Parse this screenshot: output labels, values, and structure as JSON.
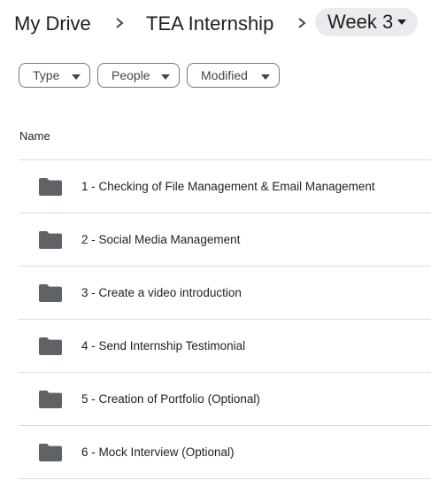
{
  "breadcrumb": {
    "items": [
      {
        "label": "My Drive"
      },
      {
        "label": "TEA Internship"
      }
    ],
    "current": {
      "label": "Week 3"
    }
  },
  "filters": {
    "type": "Type",
    "people": "People",
    "modified": "Modified"
  },
  "list": {
    "column_name": "Name",
    "files": [
      {
        "name": "1 - Checking of File Management & Email Management",
        "icon": "folder-icon"
      },
      {
        "name": "2 - Social Media Management",
        "icon": "folder-icon"
      },
      {
        "name": "3 - Create a video introduction",
        "icon": "folder-icon"
      },
      {
        "name": "4 - Send Internship Testimonial",
        "icon": "folder-icon"
      },
      {
        "name": "5 - Creation of Portfolio (Optional)",
        "icon": "folder-icon"
      },
      {
        "name": "6 - Mock Interview (Optional)",
        "icon": "folder-icon"
      }
    ]
  },
  "colors": {
    "text": "#1f1f1f",
    "folder": "#5f6368",
    "divider": "#dadce0",
    "current_crumb_bg": "#e9ebee"
  }
}
